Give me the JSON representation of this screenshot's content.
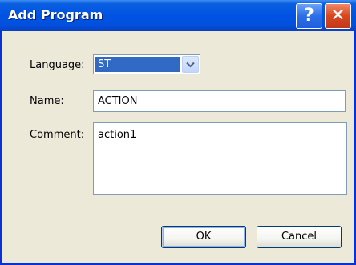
{
  "window": {
    "title": "Add Program",
    "help_label": "?",
    "close_label": "✕"
  },
  "form": {
    "language_label": "Language:",
    "language_value": "ST",
    "name_label": "Name:",
    "name_value": "ACTION",
    "comment_label": "Comment:",
    "comment_value": "action1"
  },
  "buttons": {
    "ok_label": "OK",
    "cancel_label": "Cancel"
  },
  "icons": {
    "help": "help-icon",
    "close": "close-icon",
    "dropdown": "chevron-down-icon"
  },
  "colors": {
    "titlebar": "#0054e3",
    "selection": "#316ac5",
    "dialog_bg": "#ece9d8",
    "close_button": "#d9461f"
  }
}
